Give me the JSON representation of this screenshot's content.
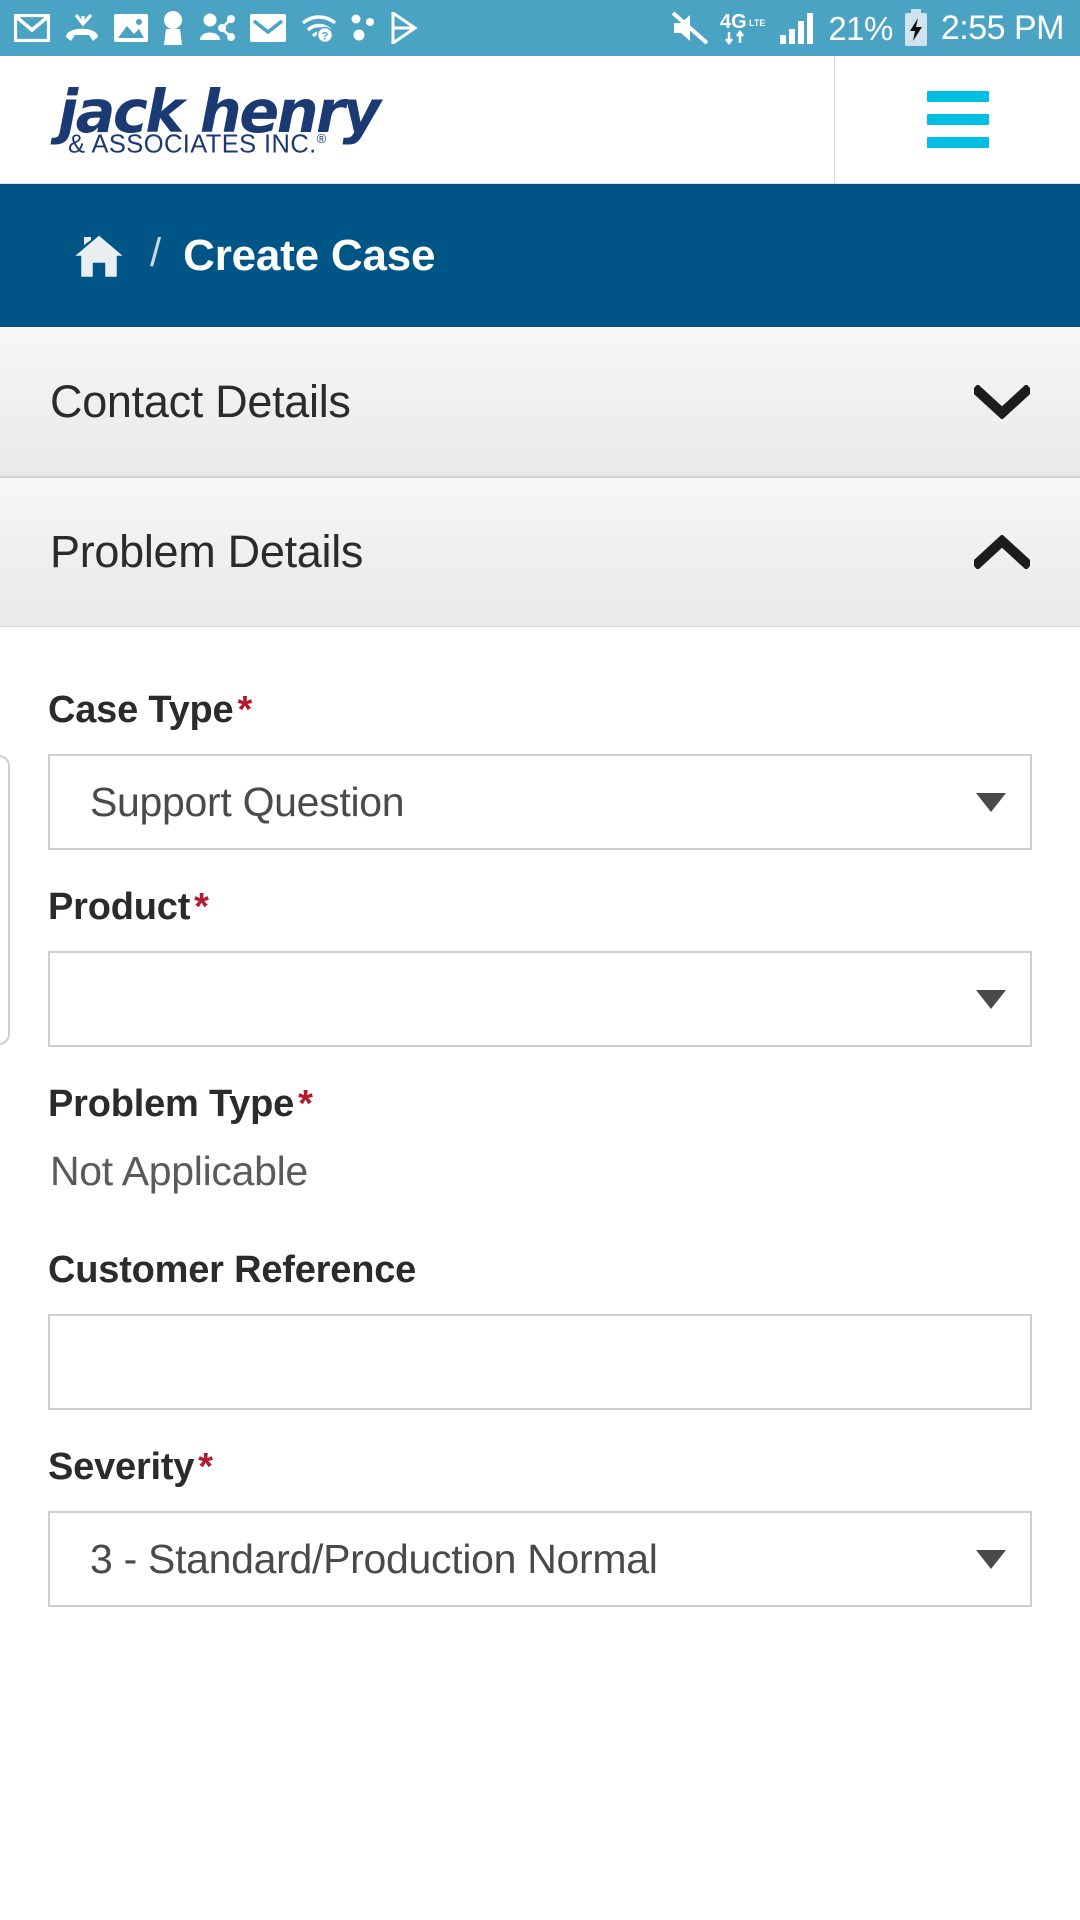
{
  "statusbar": {
    "icons_left": [
      "gmail-icon",
      "missed-call-icon",
      "screenshot-image-icon",
      "keyhole-person-icon",
      "share-contact-icon",
      "mail-icon",
      "wifi-question-icon",
      "dots-icon",
      "play-store-icon"
    ],
    "mute_icon": "volume-muted-icon",
    "network_label": "4G",
    "network_sub": "LTE",
    "signal_icon": "signal-bars-icon",
    "battery_percent": "21%",
    "battery_icon": "battery-charging-icon",
    "time": "2:55 PM",
    "bg_color": "#4ba3c3"
  },
  "header": {
    "logo_main": "jack henry",
    "logo_sub": "& ASSOCIATES INC.",
    "logo_registered": "®",
    "logo_color": "#1b3a73",
    "menu_icon": "hamburger-menu-icon",
    "menu_color": "#00bfe3"
  },
  "breadcrumb": {
    "home_icon": "home-icon",
    "separator": "/",
    "title": "Create Case",
    "bg_color": "#005587"
  },
  "accordions": [
    {
      "title": "Contact Details",
      "state": "collapsed",
      "chevron": "chevron-down-icon"
    },
    {
      "title": "Problem Details",
      "state": "expanded",
      "chevron": "chevron-up-icon"
    }
  ],
  "form": {
    "required_marker": "*",
    "required_color": "#b31b2c",
    "fields": [
      {
        "label": "Case Type",
        "required": true,
        "type": "select",
        "value": "Support Question",
        "caret": "caret-down-icon"
      },
      {
        "label": "Product",
        "required": true,
        "type": "select",
        "value": "",
        "caret": "caret-down-icon"
      },
      {
        "label": "Problem Type",
        "required": true,
        "type": "static",
        "value": "Not Applicable"
      },
      {
        "label": "Customer Reference",
        "required": false,
        "type": "text",
        "value": "",
        "placeholder": ""
      },
      {
        "label": "Severity",
        "required": true,
        "type": "select",
        "value": "3 - Standard/Production Normal",
        "caret": "caret-down-icon"
      }
    ]
  }
}
